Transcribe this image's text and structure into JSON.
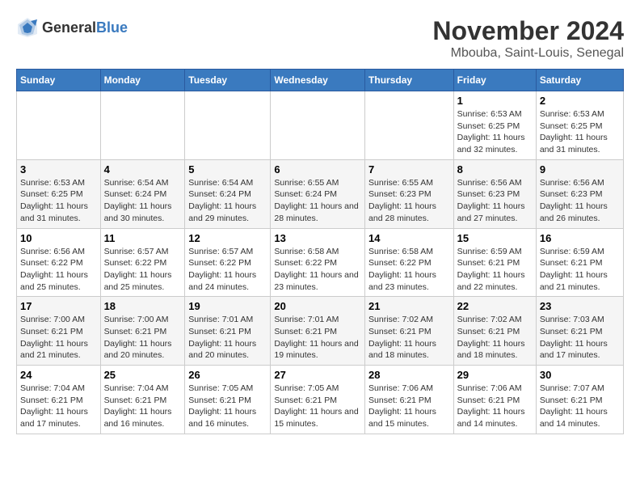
{
  "header": {
    "logo_general": "General",
    "logo_blue": "Blue",
    "title": "November 2024",
    "location": "Mbouba, Saint-Louis, Senegal"
  },
  "weekdays": [
    "Sunday",
    "Monday",
    "Tuesday",
    "Wednesday",
    "Thursday",
    "Friday",
    "Saturday"
  ],
  "weeks": [
    [
      {
        "day": "",
        "info": ""
      },
      {
        "day": "",
        "info": ""
      },
      {
        "day": "",
        "info": ""
      },
      {
        "day": "",
        "info": ""
      },
      {
        "day": "",
        "info": ""
      },
      {
        "day": "1",
        "info": "Sunrise: 6:53 AM\nSunset: 6:25 PM\nDaylight: 11 hours and 32 minutes."
      },
      {
        "day": "2",
        "info": "Sunrise: 6:53 AM\nSunset: 6:25 PM\nDaylight: 11 hours and 31 minutes."
      }
    ],
    [
      {
        "day": "3",
        "info": "Sunrise: 6:53 AM\nSunset: 6:25 PM\nDaylight: 11 hours and 31 minutes."
      },
      {
        "day": "4",
        "info": "Sunrise: 6:54 AM\nSunset: 6:24 PM\nDaylight: 11 hours and 30 minutes."
      },
      {
        "day": "5",
        "info": "Sunrise: 6:54 AM\nSunset: 6:24 PM\nDaylight: 11 hours and 29 minutes."
      },
      {
        "day": "6",
        "info": "Sunrise: 6:55 AM\nSunset: 6:24 PM\nDaylight: 11 hours and 28 minutes."
      },
      {
        "day": "7",
        "info": "Sunrise: 6:55 AM\nSunset: 6:23 PM\nDaylight: 11 hours and 28 minutes."
      },
      {
        "day": "8",
        "info": "Sunrise: 6:56 AM\nSunset: 6:23 PM\nDaylight: 11 hours and 27 minutes."
      },
      {
        "day": "9",
        "info": "Sunrise: 6:56 AM\nSunset: 6:23 PM\nDaylight: 11 hours and 26 minutes."
      }
    ],
    [
      {
        "day": "10",
        "info": "Sunrise: 6:56 AM\nSunset: 6:22 PM\nDaylight: 11 hours and 25 minutes."
      },
      {
        "day": "11",
        "info": "Sunrise: 6:57 AM\nSunset: 6:22 PM\nDaylight: 11 hours and 25 minutes."
      },
      {
        "day": "12",
        "info": "Sunrise: 6:57 AM\nSunset: 6:22 PM\nDaylight: 11 hours and 24 minutes."
      },
      {
        "day": "13",
        "info": "Sunrise: 6:58 AM\nSunset: 6:22 PM\nDaylight: 11 hours and 23 minutes."
      },
      {
        "day": "14",
        "info": "Sunrise: 6:58 AM\nSunset: 6:22 PM\nDaylight: 11 hours and 23 minutes."
      },
      {
        "day": "15",
        "info": "Sunrise: 6:59 AM\nSunset: 6:21 PM\nDaylight: 11 hours and 22 minutes."
      },
      {
        "day": "16",
        "info": "Sunrise: 6:59 AM\nSunset: 6:21 PM\nDaylight: 11 hours and 21 minutes."
      }
    ],
    [
      {
        "day": "17",
        "info": "Sunrise: 7:00 AM\nSunset: 6:21 PM\nDaylight: 11 hours and 21 minutes."
      },
      {
        "day": "18",
        "info": "Sunrise: 7:00 AM\nSunset: 6:21 PM\nDaylight: 11 hours and 20 minutes."
      },
      {
        "day": "19",
        "info": "Sunrise: 7:01 AM\nSunset: 6:21 PM\nDaylight: 11 hours and 20 minutes."
      },
      {
        "day": "20",
        "info": "Sunrise: 7:01 AM\nSunset: 6:21 PM\nDaylight: 11 hours and 19 minutes."
      },
      {
        "day": "21",
        "info": "Sunrise: 7:02 AM\nSunset: 6:21 PM\nDaylight: 11 hours and 18 minutes."
      },
      {
        "day": "22",
        "info": "Sunrise: 7:02 AM\nSunset: 6:21 PM\nDaylight: 11 hours and 18 minutes."
      },
      {
        "day": "23",
        "info": "Sunrise: 7:03 AM\nSunset: 6:21 PM\nDaylight: 11 hours and 17 minutes."
      }
    ],
    [
      {
        "day": "24",
        "info": "Sunrise: 7:04 AM\nSunset: 6:21 PM\nDaylight: 11 hours and 17 minutes."
      },
      {
        "day": "25",
        "info": "Sunrise: 7:04 AM\nSunset: 6:21 PM\nDaylight: 11 hours and 16 minutes."
      },
      {
        "day": "26",
        "info": "Sunrise: 7:05 AM\nSunset: 6:21 PM\nDaylight: 11 hours and 16 minutes."
      },
      {
        "day": "27",
        "info": "Sunrise: 7:05 AM\nSunset: 6:21 PM\nDaylight: 11 hours and 15 minutes."
      },
      {
        "day": "28",
        "info": "Sunrise: 7:06 AM\nSunset: 6:21 PM\nDaylight: 11 hours and 15 minutes."
      },
      {
        "day": "29",
        "info": "Sunrise: 7:06 AM\nSunset: 6:21 PM\nDaylight: 11 hours and 14 minutes."
      },
      {
        "day": "30",
        "info": "Sunrise: 7:07 AM\nSunset: 6:21 PM\nDaylight: 11 hours and 14 minutes."
      }
    ]
  ]
}
